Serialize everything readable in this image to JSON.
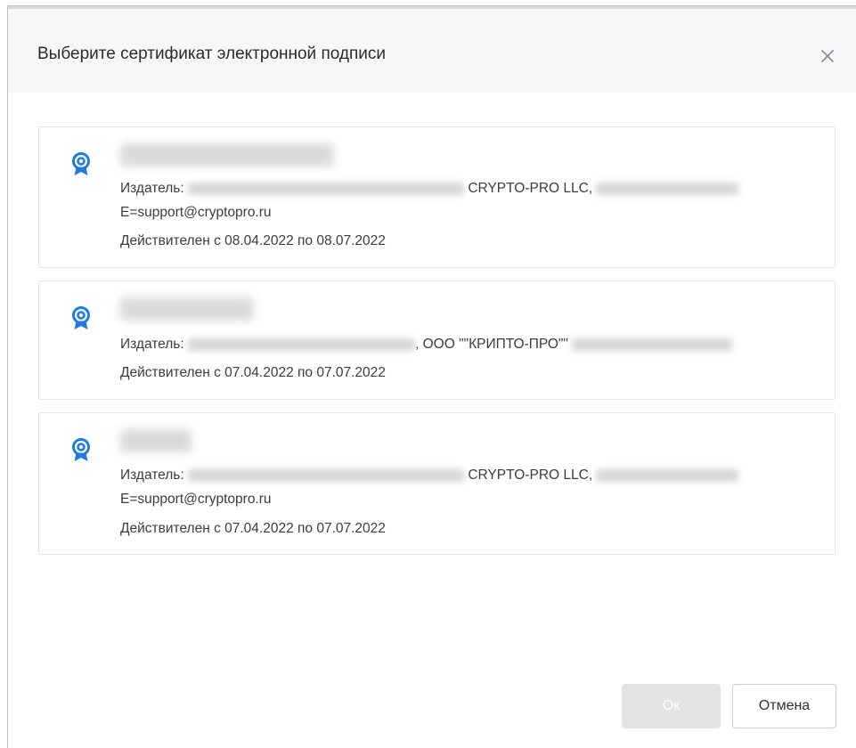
{
  "dialog": {
    "title": "Выберите сертификат электронной подписи",
    "close_icon": "close-icon",
    "accent_color": "#1e7be6"
  },
  "certificates": [
    {
      "icon": "certificate-badge-icon",
      "issuer_label": "Издатель:",
      "issuer_visible": "CRYPTO-PRO LLC,",
      "issuer_email": "E=support@cryptopro.ru",
      "validity": "Действителен с 08.04.2022 по 08.07.2022"
    },
    {
      "icon": "certificate-badge-icon",
      "issuer_label": "Издатель:",
      "issuer_visible": ", ООО \"\"КРИПТО-ПРО\"\"",
      "validity": "Действителен с 07.04.2022 по 07.07.2022"
    },
    {
      "icon": "certificate-badge-icon",
      "issuer_label": "Издатель:",
      "issuer_visible": "CRYPTO-PRO LLC,",
      "issuer_email": "E=support@cryptopro.ru",
      "validity": "Действителен с 07.04.2022 по 07.07.2022"
    }
  ],
  "footer": {
    "ok_label": "Ок",
    "cancel_label": "Отмена"
  }
}
